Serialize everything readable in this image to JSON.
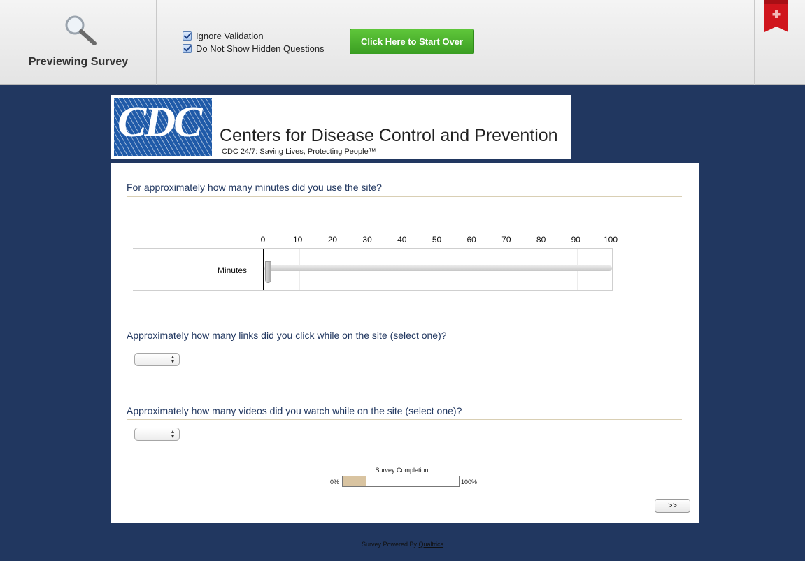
{
  "preview": {
    "title": "Previewing Survey",
    "options": [
      {
        "label": "Ignore Validation",
        "checked": true
      },
      {
        "label": "Do Not Show Hidden Questions",
        "checked": true
      }
    ],
    "start_over_label": "Click Here to Start Over"
  },
  "banner": {
    "logo_text": "CDC",
    "org_name": "Centers for Disease Control and Prevention",
    "tagline": "CDC 24/7: Saving Lives, Protecting People™"
  },
  "questions": {
    "q1": {
      "text": "For approximately how many minutes did you use the site?",
      "slider_label": "Minutes",
      "ticks": [
        "0",
        "10",
        "20",
        "30",
        "40",
        "50",
        "60",
        "70",
        "80",
        "90",
        "100"
      ],
      "min": 0,
      "max": 100,
      "value": 0
    },
    "q2": {
      "text": "Approximately how many links did you click while on the site (select one)?",
      "selected": ""
    },
    "q3": {
      "text": "Approximately how many videos did you watch while on the site (select one)?",
      "selected": ""
    }
  },
  "progress": {
    "title": "Survey Completion",
    "low_label": "0%",
    "high_label": "100%",
    "value_percent": 20
  },
  "next_label": ">>",
  "footer": {
    "prefix": "Survey Powered By ",
    "link": "Qualtrics"
  },
  "colors": {
    "page_background": "#213760",
    "question_text": "#213760",
    "start_button": "#4bb22e",
    "progress_fill": "#d9c4a1",
    "flag": "#d0151d"
  },
  "icons": [
    "magnifier-icon",
    "bookmark-flag-icon",
    "checkbox-checked-icon",
    "select-arrows-icon"
  ]
}
